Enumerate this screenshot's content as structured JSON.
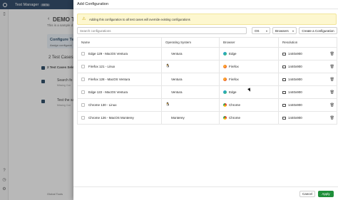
{
  "app": {
    "title": "Test Manager",
    "badge": "BETA"
  },
  "background": {
    "page_title": "DEMO Tes",
    "subtitle": "This is a sample d",
    "card_title": "Configure Tes",
    "card_sub": "Assign configurat",
    "test_cases_count": "2 Test Cases",
    "selected_label": "2 Test Cases Sele",
    "items": [
      {
        "title": "Search fo",
        "sub": "Missing Con"
      },
      {
        "title": "Test the sa",
        "sub": "Missing Con"
      }
    ],
    "bottom_text": "Global Tools"
  },
  "modal": {
    "title": "Add Configuration",
    "warning": "Adding this configuration to all test cases will override existing configurations",
    "search_placeholder": "Search configurations",
    "os_filter": "OS",
    "browsers_filter": "Browsers",
    "create_button": "Create a Configuration",
    "columns": {
      "name": "Name",
      "os": "Operating System",
      "browser": "Browser",
      "resolution": "Resolution"
    },
    "rows": [
      {
        "name": "Edge 129 - MacOS Ventura",
        "os": "Ventura",
        "os_icon": "apple-icon",
        "browser": "Edge",
        "browser_icon": "edge-icon",
        "resolution": "1440x900"
      },
      {
        "name": "Firefox 121 - Linux",
        "os": "",
        "os_icon": "linux-icon",
        "browser": "Firefox",
        "browser_icon": "firefox-icon",
        "resolution": "1440x900"
      },
      {
        "name": "Firefox 128 - MacOS Ventura",
        "os": "Ventura",
        "os_icon": "apple-icon",
        "browser": "Firefox",
        "browser_icon": "firefox-icon",
        "resolution": "1440x900"
      },
      {
        "name": "Edge 122 - MacOS Ventura",
        "os": "Ventura",
        "os_icon": "apple-icon",
        "browser": "Edge",
        "browser_icon": "edge-icon",
        "resolution": "1440x900"
      },
      {
        "name": "Chrome 130 - Linux",
        "os": "",
        "os_icon": "linux-icon",
        "browser": "Chrome",
        "browser_icon": "chrome-icon",
        "resolution": "1440x900"
      },
      {
        "name": "Chrome 126 - MacOS Monterey",
        "os": "Monterey",
        "os_icon": "apple-icon",
        "browser": "Chrome",
        "browser_icon": "chrome-icon",
        "resolution": "1440x900"
      }
    ],
    "cancel_button": "Cancel",
    "apply_button": "Apply"
  },
  "colors": {
    "topbar": "#1c3a5b",
    "apply": "#1f8f3a",
    "warning_bg": "#fdf7cf"
  }
}
